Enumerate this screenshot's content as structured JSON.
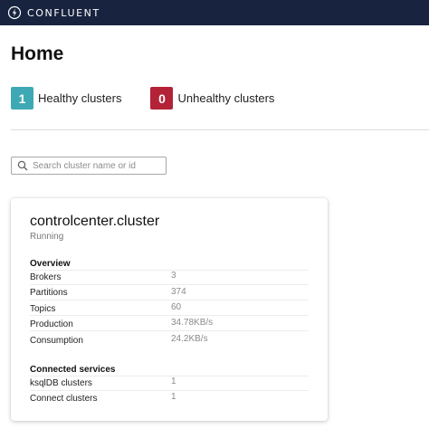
{
  "header": {
    "brand": "CONFLUENT",
    "icon": "lightning-logo-icon",
    "bg_color": "#17233f"
  },
  "page": {
    "title": "Home"
  },
  "summary": {
    "healthy": {
      "count": "1",
      "label": "Healthy clusters",
      "color": "#3ea9b4"
    },
    "unhealthy": {
      "count": "0",
      "label": "Unhealthy clusters",
      "color": "#b32237"
    }
  },
  "search": {
    "placeholder": "Search cluster name or id",
    "value": "",
    "icon": "search-icon"
  },
  "cluster": {
    "name": "controlcenter.cluster",
    "status": "Running",
    "overview": {
      "title": "Overview",
      "rows": [
        {
          "label": "Brokers",
          "value": "3"
        },
        {
          "label": "Partitions",
          "value": "374"
        },
        {
          "label": "Topics",
          "value": "60"
        },
        {
          "label": "Production",
          "value": "34.78KB/s"
        },
        {
          "label": "Consumption",
          "value": "24.2KB/s"
        }
      ]
    },
    "services": {
      "title": "Connected services",
      "rows": [
        {
          "label": "ksqlDB clusters",
          "value": "1"
        },
        {
          "label": "Connect clusters",
          "value": "1"
        }
      ]
    }
  }
}
